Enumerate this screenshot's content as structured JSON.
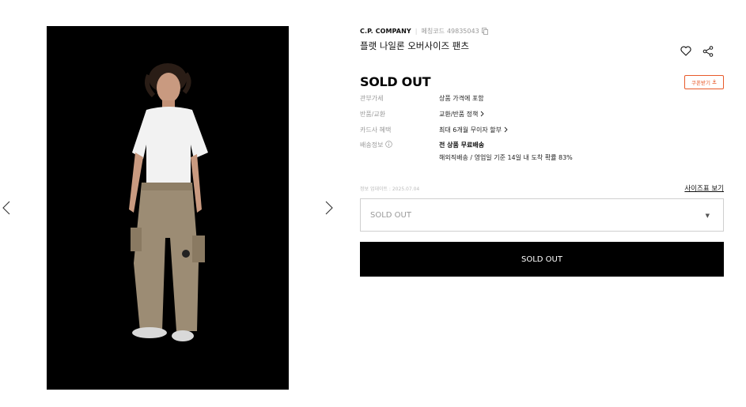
{
  "gallery": {
    "prev_icon": "chevron-left-icon",
    "next_icon": "chevron-right-icon",
    "image_icon": "product-model-photo"
  },
  "product": {
    "brand": "C.P. COMPANY",
    "code_label": "페칭코드",
    "code": "49835043",
    "name": "플랫 나일론 오버사이즈 팬츠",
    "status_title": "SOLD OUT",
    "wishlist_icon": "heart-icon",
    "share_icon": "share-icon",
    "coupon_label": "쿠폰받기",
    "coupon_icon": "download-icon",
    "accent_color": "#e85a2a"
  },
  "details": {
    "tax_label": "관부가세",
    "tax_value": "상품 가격에 포함",
    "return_label": "반품/교환",
    "return_value": "교환/반품 정책",
    "card_label": "카드사 혜택",
    "card_value": "최대 6개월 무이자 할부",
    "shipping_label": "배송정보",
    "shipping_free": "전 상품 무료배송",
    "shipping_detail": "해외직배송 / 영업일 기준 14일 내 도착 확률 83%"
  },
  "options": {
    "update_text": "정보 업데이트 : 2025.07.04",
    "size_guide": "사이즈표 보기",
    "select_value": "SOLD OUT",
    "button_label": "SOLD OUT"
  }
}
